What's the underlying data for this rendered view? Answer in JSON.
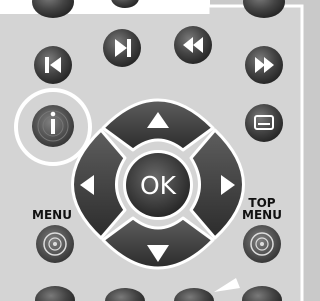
{
  "remote": {
    "ok_label": "OK",
    "menu_label": "MENU",
    "top_menu_label_line1": "TOP",
    "top_menu_label_line2": "MENU",
    "colors": {
      "panel": "#d6d6d6",
      "panel_border": "#ffffff",
      "outer_background": "#c9c9c9",
      "button_dark": "#333333",
      "button_light": "#6b6b6b",
      "glyph": "#ffffff",
      "highlight_ring": "#ffffff"
    },
    "icons": [
      "skip-back-icon",
      "skip-forward-icon",
      "rewind-icon",
      "fast-forward-icon",
      "info-icon",
      "subtitle-icon",
      "arrow-up-icon",
      "arrow-down-icon",
      "arrow-left-icon",
      "arrow-right-icon",
      "disc-icon"
    ],
    "highlighted_button": "info-button"
  }
}
